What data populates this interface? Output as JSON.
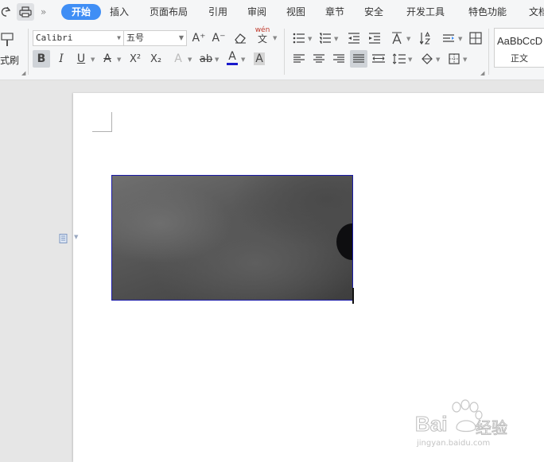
{
  "menu": {
    "tabs": [
      "开始",
      "插入",
      "页面布局",
      "引用",
      "审阅",
      "视图",
      "章节",
      "安全",
      "开发工具",
      "特色功能",
      "文档"
    ],
    "active_tab": "开始",
    "more_glyph": "»"
  },
  "toolbar": {
    "format_painter_label": "式刷",
    "font_name": "Calibri",
    "font_size": "五号",
    "bold": "B",
    "italic": "I",
    "underline": "U",
    "strike": "A",
    "superscript": "X²",
    "subscript": "X₂",
    "text_effect": "A",
    "highlight": "ab",
    "font_color": "A",
    "char_shading": "A",
    "phonetic_top": "wén",
    "phonetic_bottom": "文",
    "grow_font": "A⁺",
    "shrink_font": "A⁻",
    "style_preview": "AaBbCcD",
    "style_name": "正文",
    "accent_color": "#3f8ef5",
    "font_color_bar": "#1a1acc"
  },
  "document": {
    "image_border_color": "#1a1aa8"
  },
  "watermark": {
    "brand": "Bai",
    "brand_cn": "经验",
    "url": "jingyan.baidu.com"
  }
}
